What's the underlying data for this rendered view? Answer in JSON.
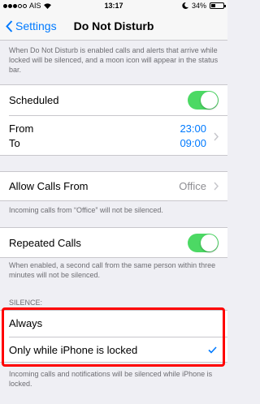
{
  "status_bar": {
    "carrier": "AIS",
    "time": "13:17",
    "battery_percent": "34%",
    "signal_bars_filled": 3,
    "battery_level": 0.34
  },
  "nav": {
    "back_label": "Settings",
    "title": "Do Not Disturb"
  },
  "intro_footer": "When Do Not Disturb is enabled calls and alerts that arrive while locked will be silenced, and a moon icon will appear in the status bar.",
  "scheduled": {
    "label": "Scheduled",
    "on": true,
    "from_label": "From",
    "to_label": "To",
    "from_time": "23:00",
    "to_time": "09:00"
  },
  "allow_calls": {
    "label": "Allow Calls From",
    "value": "Office",
    "footer": "Incoming calls from “Office” will not be silenced."
  },
  "repeated_calls": {
    "label": "Repeated Calls",
    "on": true,
    "footer": "When enabled, a second call from the same person within three minutes will not be silenced."
  },
  "silence": {
    "header": "SILENCE:",
    "options": [
      {
        "label": "Always",
        "selected": false
      },
      {
        "label": "Only while iPhone is locked",
        "selected": true
      }
    ],
    "footer": "Incoming calls and notifications will be silenced while iPhone is locked."
  },
  "colors": {
    "accent": "#007aff",
    "toggle_on": "#4cd964",
    "highlight": "#ff0000",
    "background": "#efeff4"
  }
}
